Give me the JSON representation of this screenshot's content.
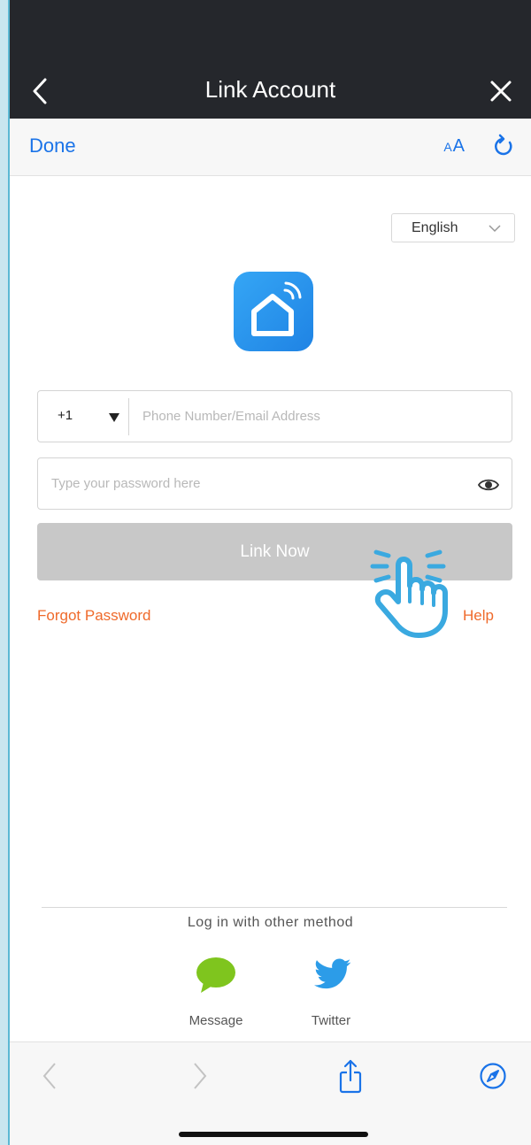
{
  "header": {
    "title": "Link Account"
  },
  "browser": {
    "done_label": "Done",
    "text_size_label_small": "A",
    "text_size_label_big": "A"
  },
  "language": {
    "selected": "English"
  },
  "form": {
    "country_code": "+1",
    "phone_placeholder": "Phone Number/Email Address",
    "password_placeholder": "Type your password here",
    "link_button": "Link Now",
    "forgot_password": "Forgot Password",
    "help": "Help"
  },
  "other_login": {
    "heading": "Log in with other method",
    "methods": [
      {
        "label": "Message",
        "icon": "message-bubble-icon"
      },
      {
        "label": "Twitter",
        "icon": "twitter-bird-icon"
      }
    ]
  },
  "colors": {
    "link_blue": "#1a73e8",
    "accent_orange": "#ef6a2b",
    "button_disabled": "#c8c8c8",
    "topbar": "#25272c",
    "logo_blue": "#2a93ee",
    "message_green": "#7fc51e",
    "twitter_blue": "#2c9ce8"
  }
}
